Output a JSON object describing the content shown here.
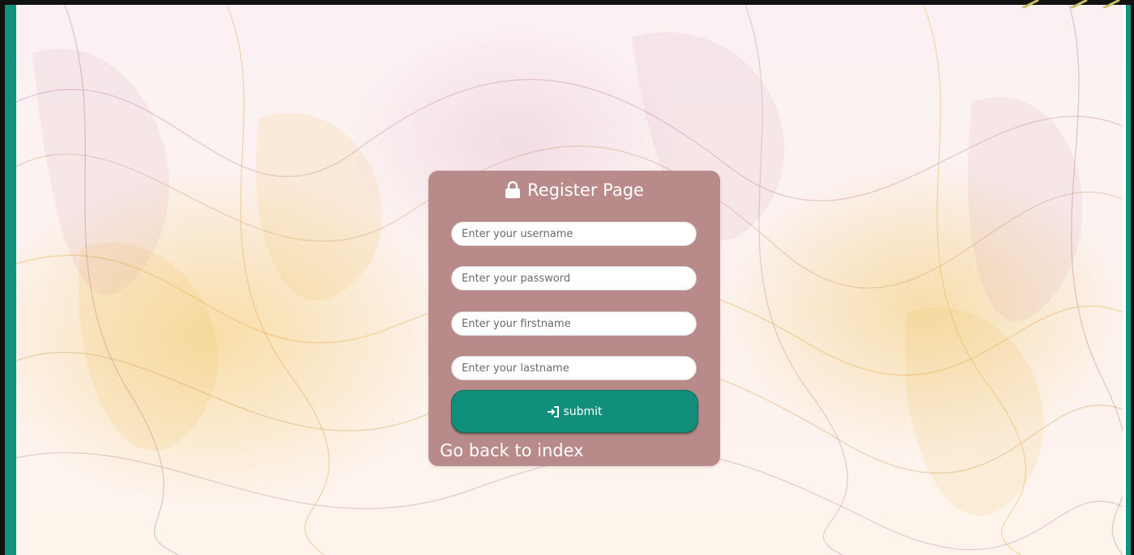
{
  "page": {
    "accent_color": "#12937e",
    "card_color": "#b88a89",
    "button_color": "#0f8f7c"
  },
  "register": {
    "title": "Register Page",
    "title_icon": "lock-icon",
    "username_placeholder": "Enter your username",
    "password_placeholder": "Enter your password",
    "firstname_placeholder": "Enter your firstname",
    "lastname_placeholder": "Enter your lastname",
    "submit_label": "submit",
    "submit_icon": "sign-in-icon",
    "back_link": "Go back to index"
  }
}
